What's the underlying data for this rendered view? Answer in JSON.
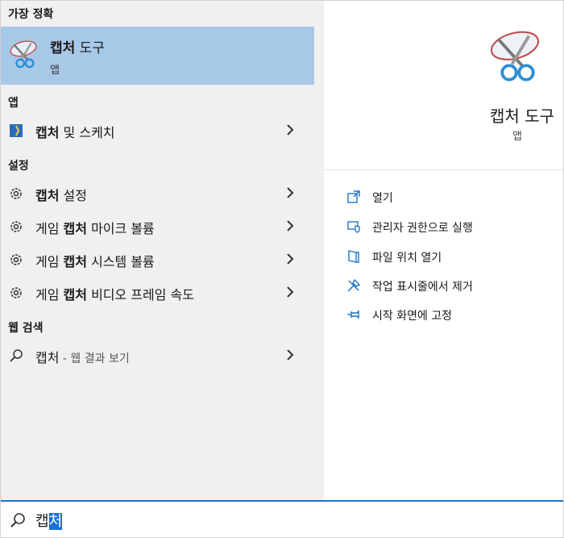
{
  "left": {
    "best_match_header": "가장 정확",
    "best_match": {
      "title_bold": "캡처",
      "title_rest": " 도구",
      "subtitle": "앱"
    },
    "apps_header": "앱",
    "apps": [
      {
        "bold": "캡처",
        "rest": " 및 스케치"
      }
    ],
    "settings_header": "설정",
    "settings": [
      {
        "pre": "",
        "bold": "캡처",
        "rest": " 설정"
      },
      {
        "pre": "게임 ",
        "bold": "캡처",
        "rest": " 마이크 볼륨"
      },
      {
        "pre": "게임 ",
        "bold": "캡처",
        "rest": " 시스템 볼륨"
      },
      {
        "pre": "게임 ",
        "bold": "캡처",
        "rest": " 비디오 프레임 속도"
      }
    ],
    "web_header": "웹 검색",
    "web": {
      "query": "캡처",
      "hint": " - 웹 결과 보기"
    }
  },
  "right": {
    "title": "캡처 도구",
    "subtitle": "앱",
    "actions": [
      {
        "label": "열기",
        "icon": "open-icon"
      },
      {
        "label": "관리자 권한으로 실행",
        "icon": "shield-icon"
      },
      {
        "label": "파일 위치 열기",
        "icon": "file-location-icon"
      },
      {
        "label": "작업 표시줄에서 제거",
        "icon": "unpin-icon"
      },
      {
        "label": "시작 화면에 고정",
        "icon": "pin-icon"
      }
    ]
  },
  "search": {
    "typed": "캡",
    "selected": "처"
  },
  "colors": {
    "accent": "#1a73c8",
    "highlight": "#a8c8e8",
    "panel": "#f0f0f0"
  }
}
